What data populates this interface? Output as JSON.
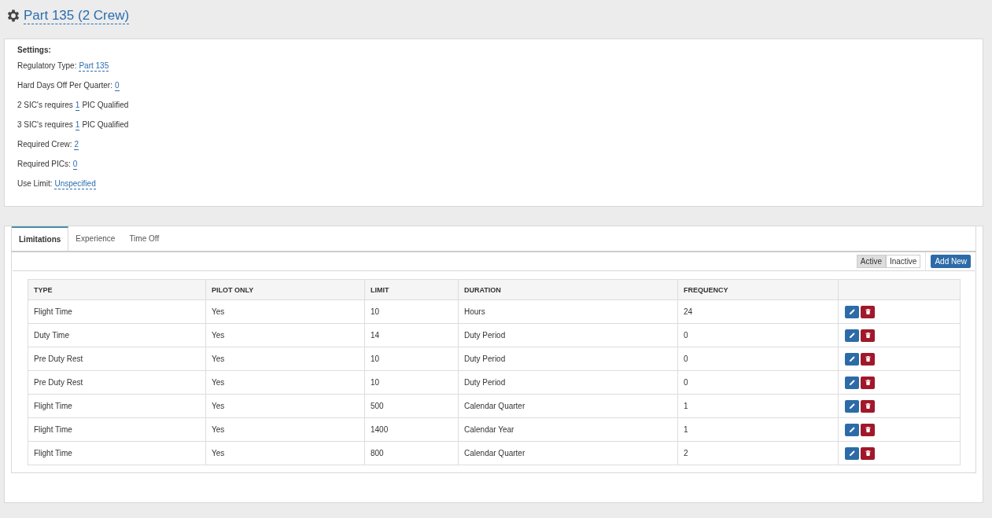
{
  "title": "Part 135 (2 Crew)",
  "settings": {
    "heading": "Settings:",
    "lines": [
      {
        "label": "Regulatory Type:",
        "value": "Part 135"
      },
      {
        "label": "Hard Days Off Per Quarter:",
        "value": "0"
      },
      {
        "label": "2 SIC's requires",
        "value": "1",
        "suffix": "PIC Qualified"
      },
      {
        "label": "3 SIC's requires",
        "value": "1",
        "suffix": "PIC Qualified"
      },
      {
        "label": "Required Crew:",
        "value": "2"
      },
      {
        "label": "Required PICs:",
        "value": "0"
      },
      {
        "label": "Use Limit:",
        "value": "Unspecified"
      }
    ]
  },
  "tabs": [
    {
      "label": "Limitations",
      "selected": true
    },
    {
      "label": "Experience",
      "selected": false
    },
    {
      "label": "Time Off",
      "selected": false
    }
  ],
  "filter": [
    {
      "label": "Active",
      "selected": true
    },
    {
      "label": "Inactive",
      "selected": false
    }
  ],
  "add_button": "Add New",
  "table": {
    "columns": [
      "TYPE",
      "PILOT ONLY",
      "LIMIT",
      "DURATION",
      "FREQUENCY"
    ],
    "rows": [
      [
        "Flight Time",
        "Yes",
        "10",
        "Hours",
        "24"
      ],
      [
        "Duty Time",
        "Yes",
        "14",
        "Duty Period",
        "0"
      ],
      [
        "Pre Duty Rest",
        "Yes",
        "10",
        "Duty Period",
        "0"
      ],
      [
        "Pre Duty Rest",
        "Yes",
        "10",
        "Duty Period",
        "0"
      ],
      [
        "Flight Time",
        "Yes",
        "500",
        "Calendar Quarter",
        "1"
      ],
      [
        "Flight Time",
        "Yes",
        "1400",
        "Calendar Year",
        "1"
      ],
      [
        "Flight Time",
        "Yes",
        "800",
        "Calendar Quarter",
        "2"
      ]
    ]
  }
}
